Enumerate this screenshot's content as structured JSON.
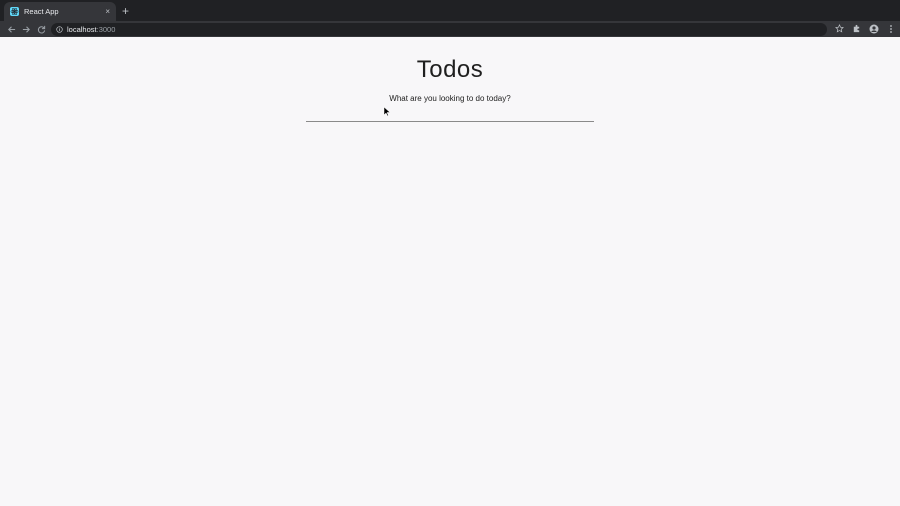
{
  "browser": {
    "tab_title": "React App",
    "tab_close": "×",
    "new_tab": "+",
    "url_host": "localhost",
    "url_port": ":3000",
    "colors": {
      "frame": "#202124",
      "toolbar": "#35363a",
      "favicon": "#61dafb"
    }
  },
  "app": {
    "title": "Todos",
    "prompt": "What are you looking to do today?",
    "input_value": ""
  }
}
